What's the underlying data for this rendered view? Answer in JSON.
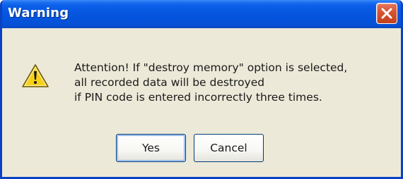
{
  "dialog": {
    "title": "Warning",
    "close_icon": "close-icon",
    "warning_icon": "warning-icon",
    "message_lines": [
      "Attention! If \"destroy memory\" option is selected,",
      "all recorded data will be destroyed",
      "if PIN code is entered incorrectly three times."
    ],
    "buttons": {
      "yes_label": "Yes",
      "cancel_label": "Cancel"
    }
  },
  "colors": {
    "titlebar": "#0656e0",
    "close_button": "#d65634",
    "dialog_background": "#ece9d8",
    "warning_yellow": "#f6d11b"
  }
}
